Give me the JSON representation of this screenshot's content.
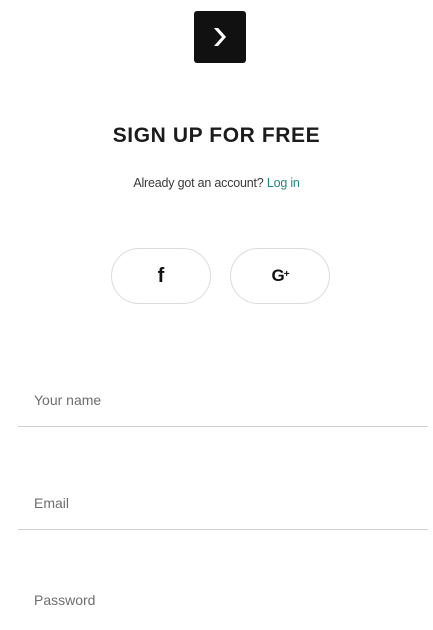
{
  "logo": {
    "icon": "chevron-right-icon"
  },
  "title": "SIGN UP FOR FREE",
  "subtitle": {
    "text": "Already got an account? ",
    "login_link": "Log in"
  },
  "social": {
    "facebook": {
      "icon": "facebook-icon",
      "glyph": "f"
    },
    "google": {
      "icon": "google-plus-icon",
      "glyph": "G",
      "plus": "+"
    }
  },
  "form": {
    "name_placeholder": "Your name",
    "email_placeholder": "Email",
    "password_placeholder": "Password"
  },
  "colors": {
    "accent_link": "#1f8a7a",
    "logo_bg": "#111111"
  }
}
